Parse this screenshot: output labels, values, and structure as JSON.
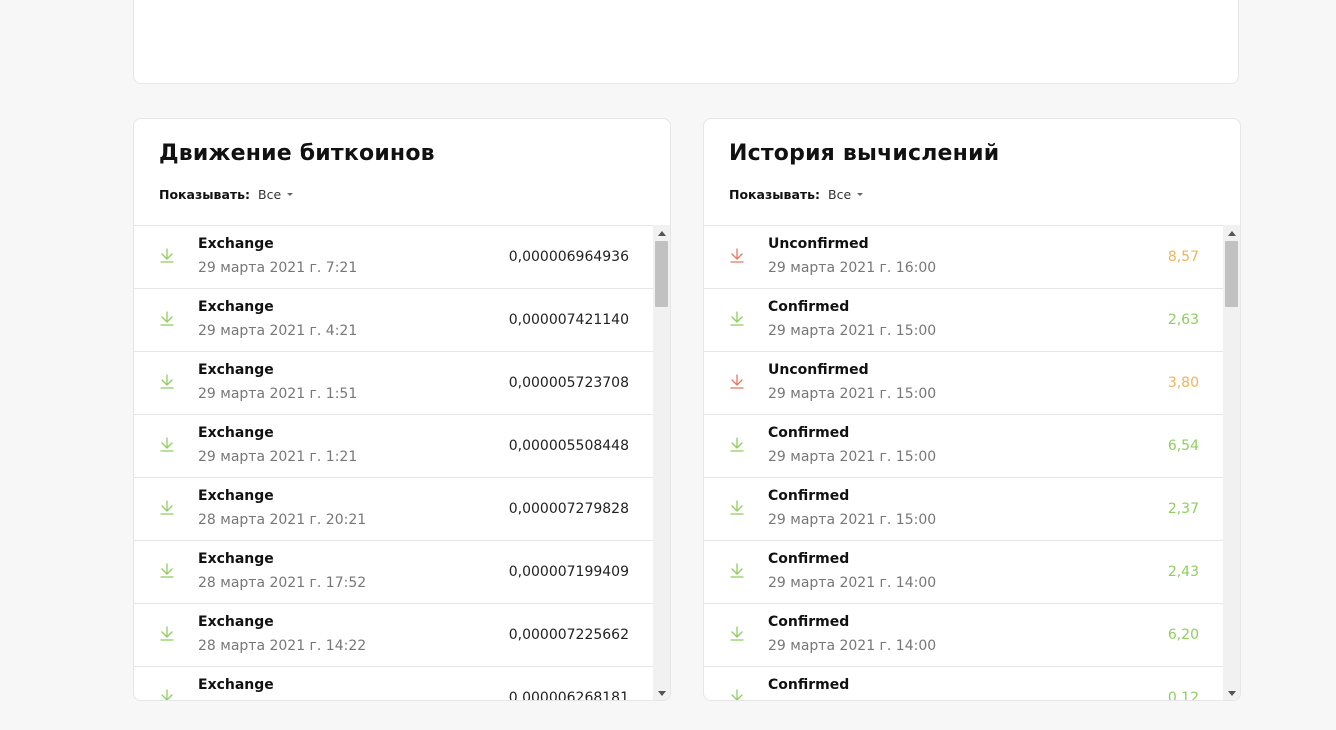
{
  "bitcoin_movements": {
    "title": "Движение биткоинов",
    "filter_label": "Показывать:",
    "filter_value": "Все",
    "icon": "download-arrow-icon",
    "icon_color": "#8fce5f",
    "rows": [
      {
        "title": "Exchange",
        "date": "29 марта 2021 г. 7:21",
        "amount": "0,000006964936"
      },
      {
        "title": "Exchange",
        "date": "29 марта 2021 г. 4:21",
        "amount": "0,000007421140"
      },
      {
        "title": "Exchange",
        "date": "29 марта 2021 г. 1:51",
        "amount": "0,000005723708"
      },
      {
        "title": "Exchange",
        "date": "29 марта 2021 г. 1:21",
        "amount": "0,000005508448"
      },
      {
        "title": "Exchange",
        "date": "28 марта 2021 г. 20:21",
        "amount": "0,000007279828"
      },
      {
        "title": "Exchange",
        "date": "28 марта 2021 г. 17:52",
        "amount": "0,000007199409"
      },
      {
        "title": "Exchange",
        "date": "28 марта 2021 г. 14:22",
        "amount": "0,000007225662"
      },
      {
        "title": "Exchange",
        "date": "",
        "amount": "0,000006268181"
      }
    ]
  },
  "computation_history": {
    "title": "История вычислений",
    "filter_label": "Показывать:",
    "filter_value": "Все",
    "colors": {
      "confirmed": "#8fce5f",
      "unconfirmed_icon": "#e8775f",
      "unconfirmed_amount": "#f2b35a"
    },
    "rows": [
      {
        "title": "Unconfirmed",
        "date": "29 марта 2021 г. 16:00",
        "amount": "8,57",
        "status": "unconfirmed"
      },
      {
        "title": "Confirmed",
        "date": "29 марта 2021 г. 15:00",
        "amount": "2,63",
        "status": "confirmed"
      },
      {
        "title": "Unconfirmed",
        "date": "29 марта 2021 г. 15:00",
        "amount": "3,80",
        "status": "unconfirmed"
      },
      {
        "title": "Confirmed",
        "date": "29 марта 2021 г. 15:00",
        "amount": "6,54",
        "status": "confirmed"
      },
      {
        "title": "Confirmed",
        "date": "29 марта 2021 г. 15:00",
        "amount": "2,37",
        "status": "confirmed"
      },
      {
        "title": "Confirmed",
        "date": "29 марта 2021 г. 14:00",
        "amount": "2,43",
        "status": "confirmed"
      },
      {
        "title": "Confirmed",
        "date": "29 марта 2021 г. 14:00",
        "amount": "6,20",
        "status": "confirmed"
      },
      {
        "title": "Confirmed",
        "date": "",
        "amount": "0,12",
        "status": "confirmed"
      }
    ]
  }
}
